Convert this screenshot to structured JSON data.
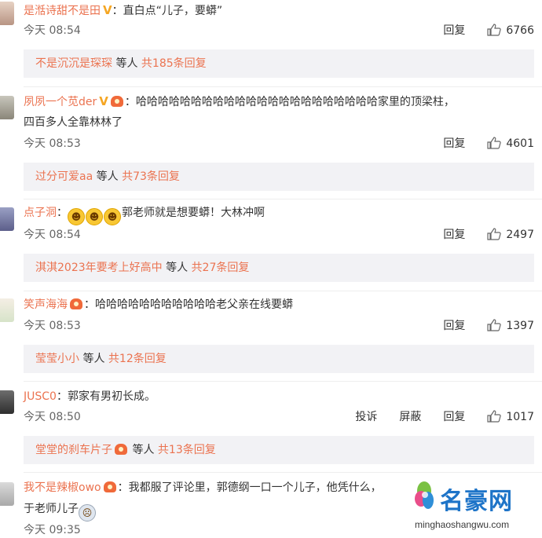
{
  "comments": [
    {
      "user": "是湉诗甜不是田",
      "verified": true,
      "text": "：直白点“儿子，要蟒”",
      "time": "今天 08:54",
      "reply": "回复",
      "likes": "6766",
      "reply_summary": {
        "user": "不是沉沉是琛琛",
        "middle": " 等人 ",
        "count": "共185条回复"
      }
    },
    {
      "user": "夙夙一个苋der",
      "verified": true,
      "medal": true,
      "text": "：哈哈哈哈哈哈哈哈哈哈哈哈哈哈哈哈哈哈哈哈哈哈家里的顶梁柱，",
      "text2": "四百多人全靠林林了",
      "time": "今天 08:53",
      "reply": "回复",
      "likes": "4601",
      "reply_summary": {
        "user": "过分可爱aa",
        "middle": " 等人 ",
        "count": "共73条回复"
      }
    },
    {
      "user": "点子洞",
      "text": "：",
      "emoji_count": 3,
      "text_after": "郭老师就是想要蟒！大林冲啊",
      "time": "今天 08:54",
      "reply": "回复",
      "likes": "2497",
      "reply_summary": {
        "user": "淇淇2023年要考上好高中",
        "middle": " 等人 ",
        "count": "共27条回复"
      }
    },
    {
      "user": "笑声海海",
      "medal": true,
      "text": "：哈哈哈哈哈哈哈哈哈哈哈老父亲在线要蟒",
      "time": "今天 08:53",
      "reply": "回复",
      "likes": "1397",
      "reply_summary": {
        "user": "莹莹小小",
        "middle": " 等人 ",
        "count": "共12条回复"
      }
    },
    {
      "user": "JUSC0",
      "text": "：郭家有男初长成。",
      "time": "今天 08:50",
      "report": "投诉",
      "block": "屏蔽",
      "reply": "回复",
      "likes": "1017",
      "reply_summary": {
        "user": "堂堂的刹车片子",
        "middle": " 等人 ",
        "count": "共13条回复"
      }
    },
    {
      "user": "我不是辣椒owo",
      "medal": true,
      "text": "：我都服了评论里，郭德纲一口一个儿子，他凭什么，",
      "text2": "于老师儿子",
      "time": "今天 09:35"
    }
  ],
  "watermark": {
    "title": "名豪网",
    "url": "minghaoshangwu.com"
  },
  "colors": {
    "username": "#eb7350",
    "reply_bg": "#f2f2f5",
    "watermark_blue": "#1e74c8"
  },
  "icons": [
    "thumb-up-icon",
    "verified-v-icon",
    "medal-icon",
    "laughing-cry-emoji"
  ]
}
